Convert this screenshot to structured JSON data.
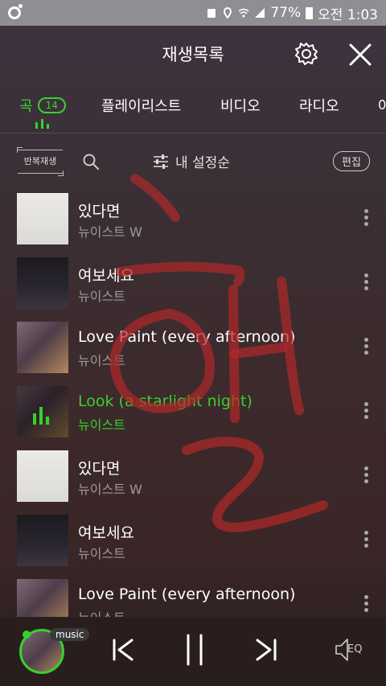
{
  "status_bar": {
    "battery": "77%",
    "time": "오전 1:03"
  },
  "header": {
    "title": "재생목록"
  },
  "tabs": [
    {
      "label": "곡",
      "badge": "14"
    },
    {
      "label": "플레이리스트"
    },
    {
      "label": "비디오"
    },
    {
      "label": "라디오"
    },
    {
      "label": "아"
    }
  ],
  "toolbar": {
    "repeat_label": "반복재생",
    "sort_label": "내 설정순",
    "edit_label": "편집"
  },
  "songs": [
    {
      "title": "있다면",
      "artist": "뉴이스트 W",
      "cover": "a",
      "active": false
    },
    {
      "title": "여보세요",
      "artist": "뉴이스트",
      "cover": "b",
      "active": false
    },
    {
      "title": "Love Paint (every afternoon)",
      "artist": "뉴이스트",
      "cover": "c",
      "active": false
    },
    {
      "title": "Look (a starlight night)",
      "artist": "뉴이스트",
      "cover": "c",
      "active": true
    },
    {
      "title": "있다면",
      "artist": "뉴이스트 W",
      "cover": "a",
      "active": false
    },
    {
      "title": "여보세요",
      "artist": "뉴이스트",
      "cover": "b",
      "active": false
    },
    {
      "title": "Love Paint (every afternoon)",
      "artist": "뉴이스트",
      "cover": "c",
      "active": false
    }
  ],
  "player": {
    "tag": "music",
    "eq_label": "EQ"
  },
  "colors": {
    "accent": "#36d12f",
    "scribble": "#b0282a"
  }
}
